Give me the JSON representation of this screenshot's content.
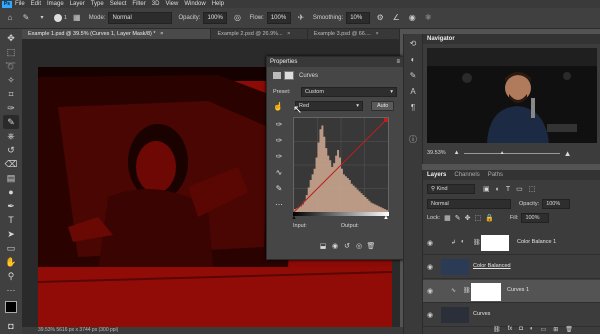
{
  "menu": [
    "File",
    "Edit",
    "Image",
    "Layer",
    "Type",
    "Select",
    "Filter",
    "3D",
    "View",
    "Window",
    "Help"
  ],
  "options": {
    "mode_label": "Mode:",
    "mode_value": "Normal",
    "opacity_label": "Opacity:",
    "opacity_value": "100%",
    "flow_label": "Flow:",
    "flow_value": "100%",
    "smoothing_label": "Smoothing:",
    "smoothing_value": "10%",
    "brush_size": "1"
  },
  "tabs": [
    {
      "label": "Example 1.psd @ 39.5% (Curves 1, Layer Mask/8) *",
      "close": "×"
    },
    {
      "label": "Example 2.psd @ 26.9%...",
      "close": "×"
    },
    {
      "label": "Example 3.psd @ 66....",
      "close": "×"
    }
  ],
  "status": "39.53%   5616 px x 3744 px (300 ppi)",
  "properties": {
    "title": "Properties",
    "subtitle": "Curves",
    "preset_label": "Preset:",
    "preset_value": "Custom",
    "channel_value": "Red",
    "auto_label": "Auto",
    "input_label": "Input:",
    "output_label": "Output:",
    "histogram": [
      3,
      4,
      5,
      6,
      8,
      12,
      18,
      26,
      34,
      40,
      46,
      58,
      74,
      88,
      92,
      80,
      68,
      60,
      55,
      48,
      52,
      60,
      66,
      58,
      46,
      40,
      38,
      36,
      34,
      30,
      28,
      26,
      24,
      22,
      20,
      18,
      16,
      14,
      12,
      10,
      9,
      8,
      7,
      6,
      5,
      4,
      3,
      2
    ]
  },
  "navigator": {
    "title": "Navigator",
    "zoom": "39.53%"
  },
  "layers": {
    "tabs": [
      "Layers",
      "Channels",
      "Paths"
    ],
    "kind_label": "Kind",
    "blend_value": "Normal",
    "opacity_label": "Opacity:",
    "opacity_value": "100%",
    "lock_label": "Lock:",
    "fill_label": "Fill:",
    "fill_value": "100%",
    "rows": [
      {
        "name": "Color Balance 1"
      },
      {
        "name": "Color Balanced"
      },
      {
        "name": "Curves 1"
      },
      {
        "name": "Curves"
      }
    ]
  },
  "colors": {
    "accent": "#31a8ff",
    "canvas_red": "#8c0b06",
    "panel": "#464646"
  }
}
